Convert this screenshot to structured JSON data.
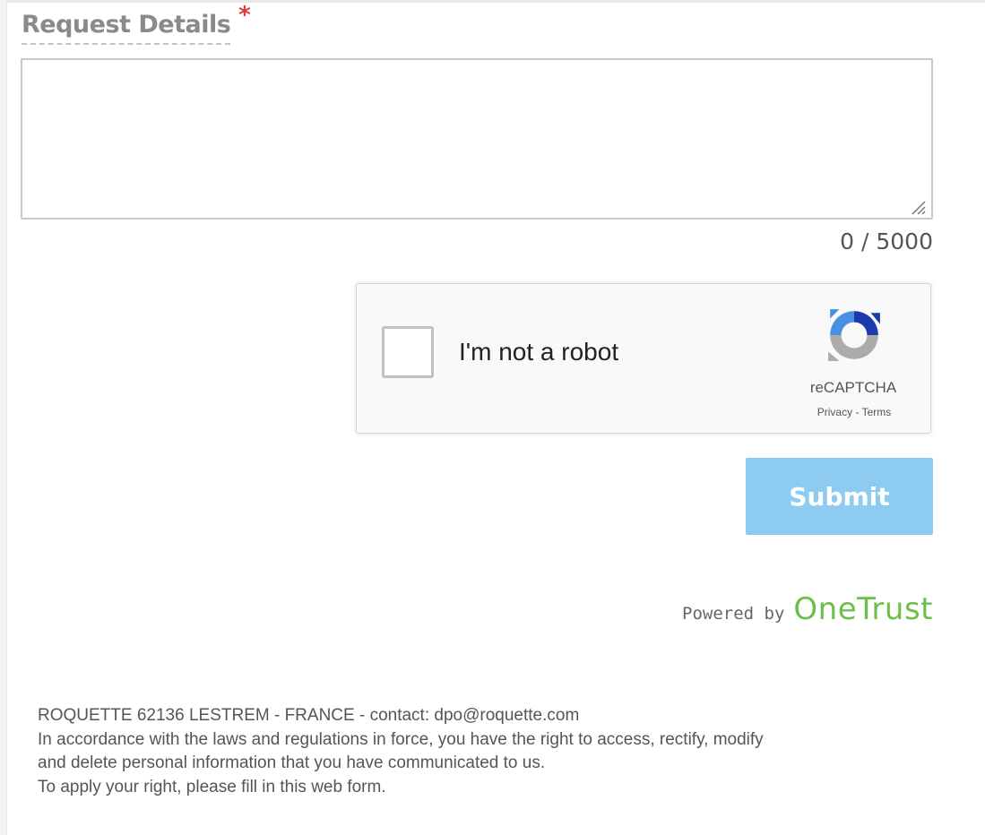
{
  "form": {
    "field_label": "Request Details",
    "required_marker": "*",
    "textarea_value": "",
    "char_counter": "0 / 5000"
  },
  "recaptcha": {
    "checkbox_label": "I'm not a robot",
    "brand": "reCAPTCHA",
    "privacy_link": "Privacy",
    "separator": " - ",
    "terms_link": "Terms",
    "checked": false
  },
  "submit": {
    "label": "Submit",
    "color": "#8ecbf0"
  },
  "powered_by": {
    "prefix": "Powered by",
    "brand": "OneTrust",
    "brand_color": "#6cc04a"
  },
  "footer": {
    "lines": [
      "ROQUETTE  62136 LESTREM - FRANCE - contact: dpo@roquette.com",
      "In accordance with the laws and regulations in force, you have the right to access, rectify, modify",
      "and delete personal information that you have communicated to us.",
      "To apply your right, please fill in this web form."
    ]
  },
  "icons": {
    "required": "asterisk",
    "resize": "resize-grip-icon",
    "recaptcha": "recaptcha-logo-icon"
  }
}
